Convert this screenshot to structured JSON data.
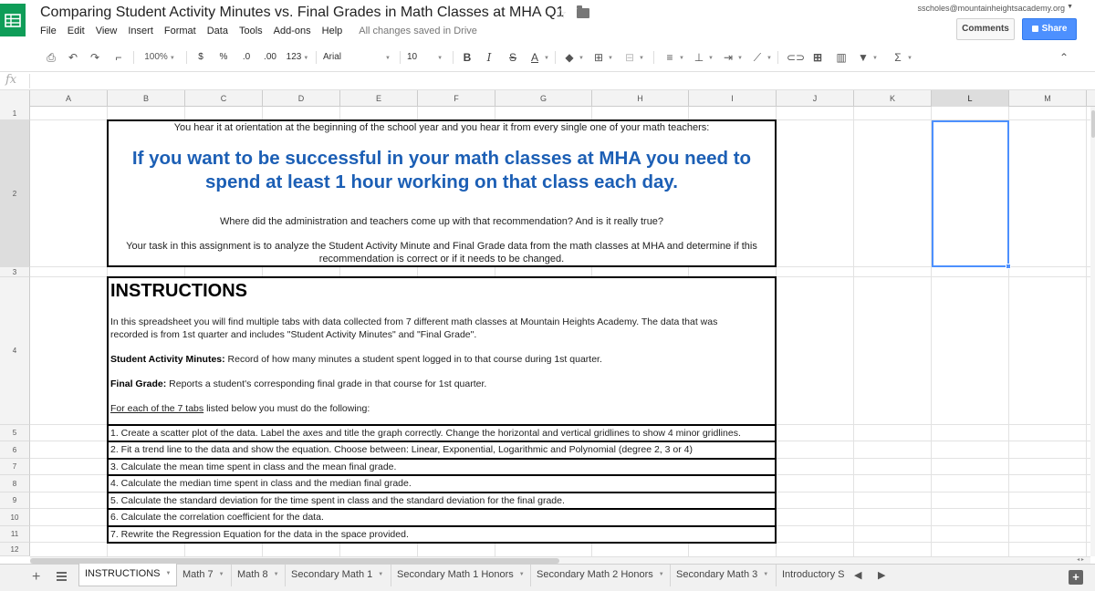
{
  "window": {
    "title": "Comparing Student Activity Minutes vs. Final Grades in Math Classes at MHA Q1",
    "user_email": "sscholes@mountainheightsacademy.org",
    "comments_label": "Comments",
    "share_label": "Share"
  },
  "menu": {
    "items": [
      "File",
      "Edit",
      "View",
      "Insert",
      "Format",
      "Data",
      "Tools",
      "Add-ons",
      "Help"
    ],
    "status": "All changes saved in Drive"
  },
  "toolbar": {
    "zoom": "100%",
    "currency": "$",
    "percent": "%",
    "decrease_decimals": ".0",
    "increase_decimals": ".00",
    "more_formats": "123",
    "font": "Arial",
    "font_size": "10",
    "bold": "B",
    "italic": "I",
    "strikethrough": "S",
    "text_color": "A"
  },
  "formula_bar": {
    "fx_label": "fx",
    "value": ""
  },
  "grid": {
    "columns": [
      "A",
      "B",
      "C",
      "D",
      "E",
      "F",
      "G",
      "H",
      "I",
      "J",
      "K",
      "L",
      "M"
    ],
    "rows": [
      "1",
      "2",
      "3",
      "4",
      "5",
      "6",
      "7",
      "8",
      "9",
      "10",
      "11",
      "12"
    ],
    "selected_column": "L",
    "selected_row": "2"
  },
  "intro": {
    "line1": "You hear it at orientation at the beginning of the school year and you hear it from every single one of your math teachers:",
    "headline_line1": "If you want to be successful in your math classes at MHA you need to",
    "headline_line2": "spend at least 1 hour working on that class each day.",
    "question": "Where did the administration and teachers come up with that recommendation? And is it really true?",
    "task_line1": "Your task in this assignment is to analyze the Student Activity Minute and Final Grade data from the math classes at MHA and determine if this",
    "task_line2": "recommendation is correct or if it needs to be changed."
  },
  "instructions": {
    "title": "INSTRUCTIONS",
    "para1_line1": "In this spreadsheet you will find multiple tabs with data collected from 7 different math classes at Mountain Heights Academy. The data that was",
    "para1_line2": "recorded is from 1st quarter and includes \"Student Activity Minutes\" and \"Final Grade\".",
    "sam_label": "Student Activity Minutes:",
    "sam_text": " Record of how many minutes a student spent logged in to that course during 1st quarter.",
    "fg_label": "Final Grade:",
    "fg_text": " Reports a student's corresponding final grade in that course for 1st quarter.",
    "tabs_prefix": "For each of the 7 tabs",
    "tabs_suffix": " listed below you must do the following:",
    "steps": [
      "1. Create a scatter plot of the data. Label the axes and title the graph correctly. Change the horizontal and vertical gridlines to show 4 minor gridlines.",
      "2. Fit a trend line to the data and show the equation. Choose between: Linear, Exponential, Logarithmic and Polynomial (degree 2, 3 or 4)",
      "3. Calculate the mean time spent in class and the mean final grade.",
      "4. Calculate the median time spent in class and the median final grade.",
      "5. Calculate the standard deviation for the time spent in class and the standard deviation for the final grade.",
      "6. Calculate the correlation coefficient for the data.",
      "7. Rewrite the Regression Equation for the data in the space provided."
    ]
  },
  "sheets": {
    "tabs": [
      "INSTRUCTIONS",
      "Math 7",
      "Math 8",
      "Secondary Math 1",
      "Secondary Math 1 Honors",
      "Secondary Math 2 Honors",
      "Secondary Math 3",
      "Introductory S"
    ],
    "active": "INSTRUCTIONS"
  },
  "colors": {
    "headline": "#1c5fb5",
    "accent": "#4d90fe",
    "logo": "#0f9d58"
  }
}
